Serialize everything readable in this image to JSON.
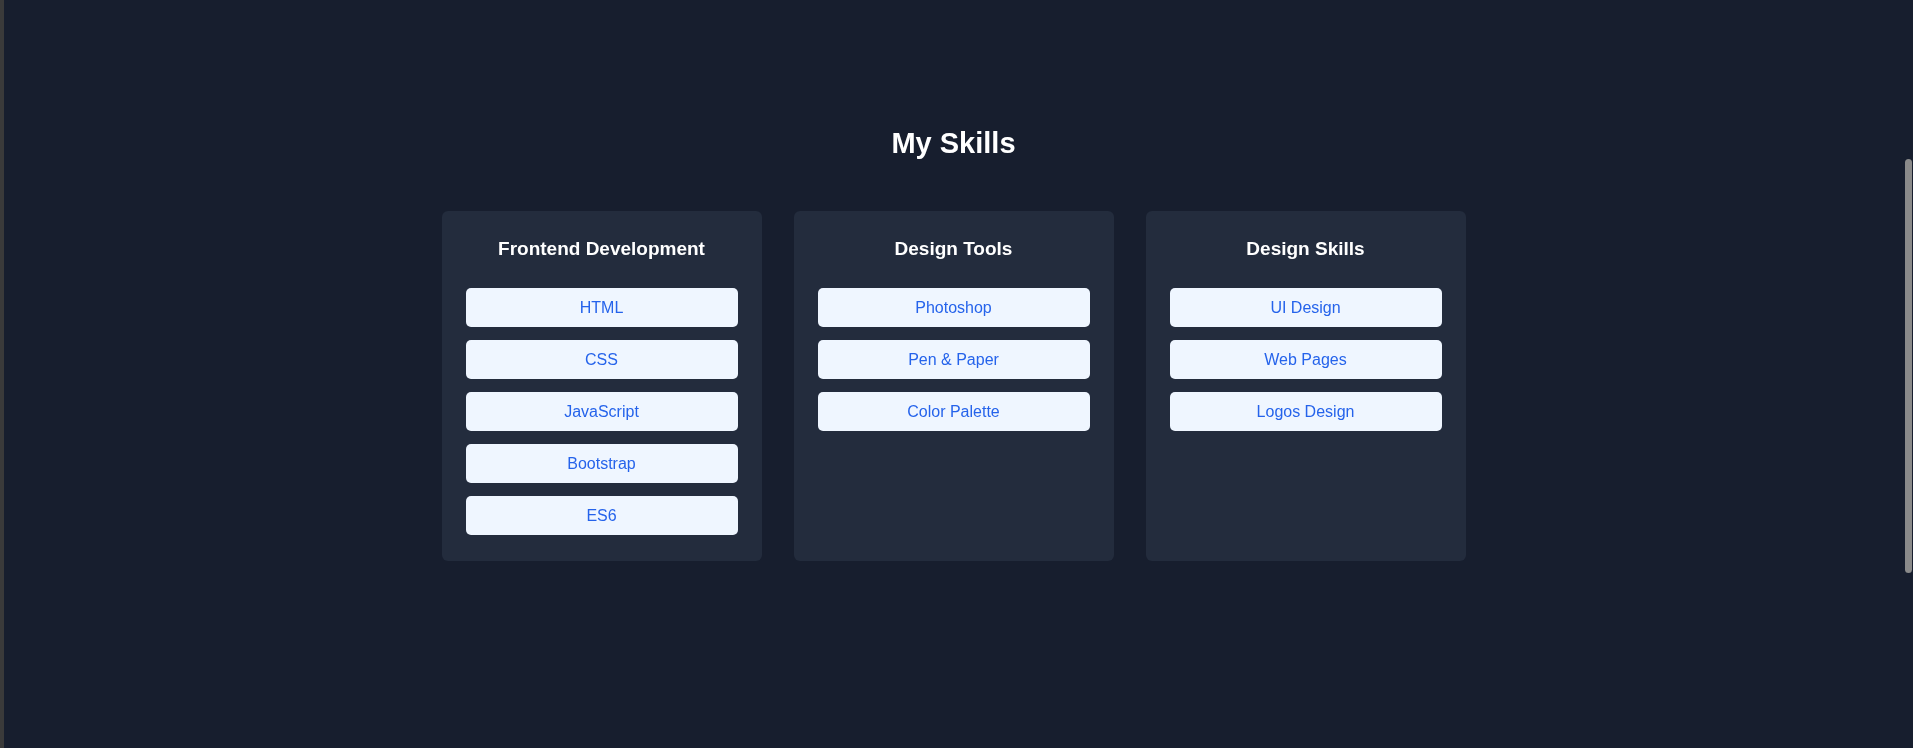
{
  "title": "My Skills",
  "cards": [
    {
      "heading": "Frontend Development",
      "skills": [
        "HTML",
        "CSS",
        "JavaScript",
        "Bootstrap",
        "ES6"
      ]
    },
    {
      "heading": "Design Tools",
      "skills": [
        "Photoshop",
        "Pen & Paper",
        "Color Palette"
      ]
    },
    {
      "heading": "Design Skills",
      "skills": [
        "UI Design",
        "Web Pages",
        "Logos Design"
      ]
    }
  ]
}
